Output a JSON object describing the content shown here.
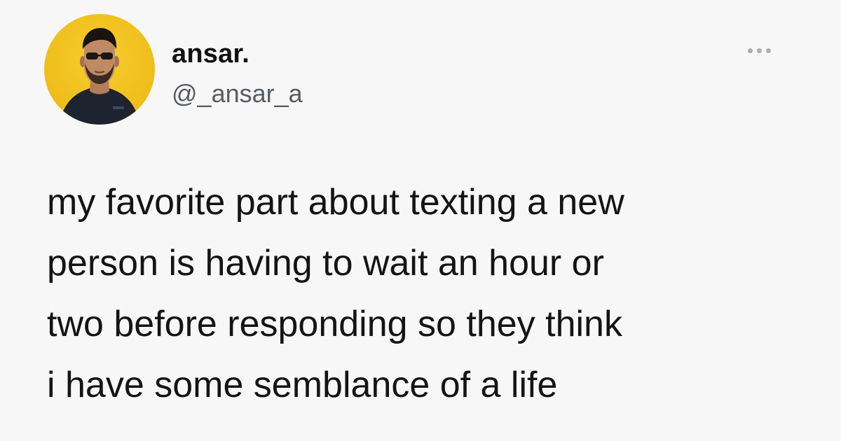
{
  "tweet": {
    "author": {
      "display_name": "ansar.",
      "handle": "@_ansar_a",
      "avatar_icon": "profile-photo",
      "avatar_background": "#f2c320"
    },
    "more_icon": "ellipsis-icon",
    "text_lines": [
      "my favorite part about texting a new",
      "person is having to wait an hour or",
      "two before responding so they think",
      "i have some semblance of a life"
    ]
  },
  "colors": {
    "background": "#f7f7f7",
    "text": "#141414",
    "handle": "#555b61",
    "more_dots": "#a8aeb4"
  }
}
